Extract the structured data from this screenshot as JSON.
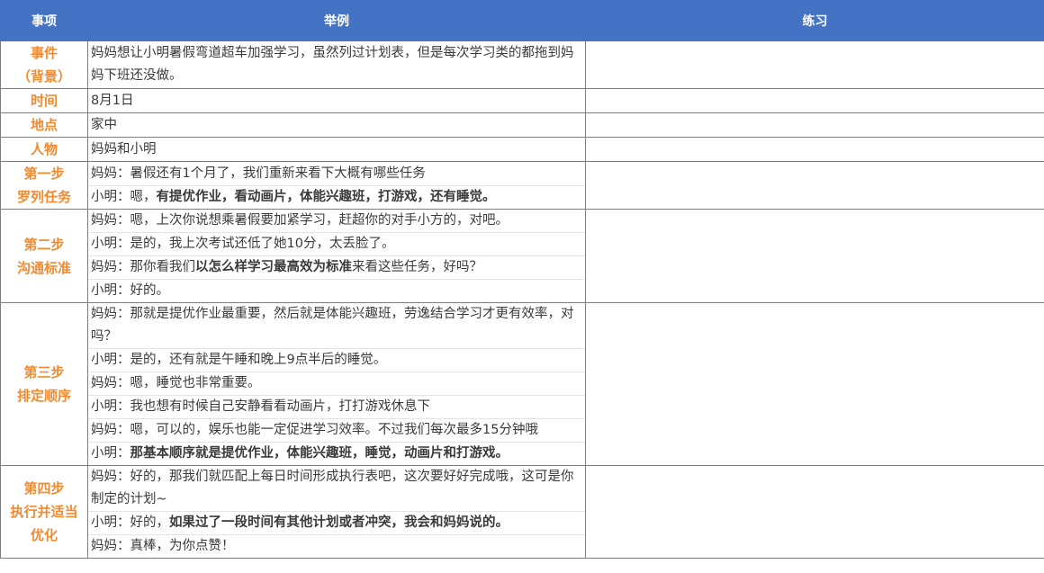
{
  "headers": {
    "col1": "事项",
    "col2": "举例",
    "col3": "练习"
  },
  "rows": {
    "event": {
      "label": [
        "事件",
        "（背景）"
      ],
      "lines": [
        {
          "prefix": "妈妈想让小明暑假弯道超车加强学习，虽然列过计划表，但是每次学习类的都拖到妈妈下班还没做。"
        }
      ]
    },
    "time": {
      "label": [
        "时间"
      ],
      "lines": [
        {
          "prefix": "8月1日"
        }
      ]
    },
    "place": {
      "label": [
        "地点"
      ],
      "lines": [
        {
          "prefix": "家中"
        }
      ]
    },
    "people": {
      "label": [
        "人物"
      ],
      "lines": [
        {
          "prefix": "妈妈和小明"
        }
      ]
    },
    "step1": {
      "label": [
        "第一步",
        "罗列任务"
      ],
      "lines": [
        {
          "prefix": "妈妈：暑假还有1个月了，我们重新来看下大概有哪些任务"
        },
        {
          "prefix": "小明：嗯，",
          "bold": "有提优作业，看动画片，体能兴趣班，打游戏，还有睡觉。"
        }
      ]
    },
    "step2": {
      "label": [
        "第二步",
        "沟通标准"
      ],
      "lines": [
        {
          "prefix": "妈妈：嗯，上次你说想乘暑假要加紧学习，赶超你的对手小方的，对吧。"
        },
        {
          "prefix": "小明：是的，我上次考试还低了她10分，太丢脸了。"
        },
        {
          "prefix": "妈妈：那你看我们",
          "bold": "以怎么样学习最高效为标准",
          "suffix": "来看这些任务，好吗？"
        },
        {
          "prefix": "小明：好的。"
        }
      ]
    },
    "step3": {
      "label": [
        "第三步",
        "排定顺序"
      ],
      "lines": [
        {
          "prefix": "妈妈：那就是提优作业最重要，然后就是体能兴趣班，劳逸结合学习才更有效率，对吗？"
        },
        {
          "prefix": "小明：是的，还有就是午睡和晚上9点半后的睡觉。"
        },
        {
          "prefix": "妈妈：嗯，睡觉也非常重要。"
        },
        {
          "prefix": "小明：我也想有时候自己安静看看动画片，打打游戏休息下"
        },
        {
          "prefix": "妈妈：嗯，可以的，娱乐也能一定促进学习效率。不过我们每次最多15分钟哦"
        },
        {
          "prefix": "小明：",
          "bold": "那基本顺序就是提优作业，体能兴趣班，睡觉，动画片和打游戏。"
        }
      ]
    },
    "step4": {
      "label": [
        "第四步",
        "执行并适当",
        "优化"
      ],
      "lines": [
        {
          "prefix": "妈妈：好的，那我们就匹配上每日时间形成执行表吧，这次要好好完成哦，这可是你制定的计划~"
        },
        {
          "prefix": "小明：好的，",
          "bold": "如果过了一段时间有其他计划或者冲突，我会和妈妈说的。"
        },
        {
          "prefix": "妈妈：真棒，为你点赞！"
        }
      ]
    }
  }
}
